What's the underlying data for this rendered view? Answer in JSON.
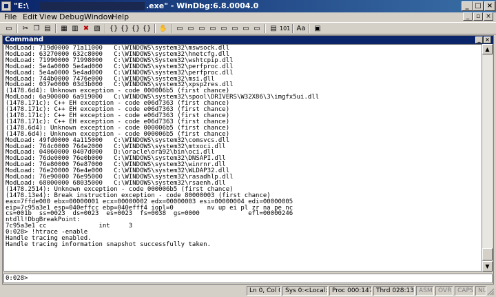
{
  "window": {
    "title_prefix": "\"E:\\",
    "title_suffix": ".exe\" - WinDbg:6.8.0004.0",
    "buttons": [
      "_",
      "□",
      "×"
    ]
  },
  "menu": [
    "File",
    "Edit",
    "View",
    "Debug",
    "Window",
    "Help"
  ],
  "toolbar_icons": [
    "open-icon",
    "cut-icon",
    "copy-icon",
    "paste-icon",
    "go-icon",
    "restart-icon",
    "stop-debugging-icon",
    "break-icon",
    "step-into-icon",
    "step-over-icon",
    "step-out-icon",
    "run-to-cursor-icon",
    "breakpoint-icon",
    "command-icon",
    "watch-icon",
    "locals-icon",
    "registers-icon",
    "memory-icon",
    "call-stack-icon",
    "disassembly-icon",
    "scratch-pad-icon",
    "source-mode-icon",
    "font-icon",
    "options-icon"
  ],
  "command_window": {
    "title": "Command",
    "output_lines": [
      "ModLoad: 719d0000 71a11000   C:\\WINDOWS\\system32\\mswsock.dll",
      "ModLoad: 63270000 632c8000   C:\\WINDOWS\\system32\\hnetcfg.dll",
      "ModLoad: 71990000 71998000   C:\\WINDOWS\\System32\\wshtcpip.dll",
      "ModLoad: 5e4a0000 5e4ad000   C:\\WINDOWS\\system32\\perfproc.dll",
      "ModLoad: 5e4a0000 5e4ad000   C:\\WINDOWS\\system32\\perfproc.dll",
      "ModLoad: 744b0000 7476e000   C:\\WINDOWS\\system32\\msi.dll",
      "ModLoad: 037e0000 03d3b000   C:\\WINDOWS\\system32\\xpsp2res.dll",
      "(1478.6d4): Unknown exception - code 000006b5 (first chance)",
      "ModLoad: 6a900000 6a919000   C:\\WINDOWS\\system32\\spool\\DRIVERS\\W32X86\\3\\imgfx5ui.dll",
      "(1478.171c): C++ EH exception - code e06d7363 (first chance)",
      "(1478.171c): C++ EH exception - code e06d7363 (first chance)",
      "(1478.171c): C++ EH exception - code e06d7363 (first chance)",
      "(1478.171c): C++ EH exception - code e06d7363 (first chance)",
      "(1478.6d4): Unknown exception - code 000006b5 (first chance)",
      "(1478.6d4): Unknown exception - code 000006b5 (first chance)",
      "ModLoad: 49fd0000 4a115000   C:\\WINDOWS\\system32\\comsvcs.dll",
      "ModLoad: 764c0000 764e2000   C:\\WINDOWS\\system32\\mtxoci.dll",
      "ModLoad: 04060000 0407d000   D:\\oracle\\ora92\\bin\\oci.dll",
      "ModLoad: 76de0000 76e0b000   C:\\WINDOWS\\system32\\DNSAPI.dll",
      "ModLoad: 76e80000 76e87000   C:\\WINDOWS\\system32\\winrnr.dll",
      "ModLoad: 76e20000 76e4e000   C:\\WINDOWS\\system32\\WLDAP32.dll",
      "ModLoad: 76e90000 76e95000   C:\\WINDOWS\\system32\\rasadhlp.dll",
      "ModLoad: 68000000 68035000   C:\\WINDOWS\\system32\\rsaenh.dll",
      "(1478.2514): Unknown exception - code 000006b5 (first chance)",
      "(1478.13e4): Break instruction exception - code 80000003 (first chance)",
      "eax=7ffde000 ebx=00000001 ecx=00000002 edx=00000003 esi=00000004 edi=00000005",
      "eip=7c95a3e1 esp=040effcc ebp=040efff4 iopl=0         nv up ei pl zr na pe nc",
      "cs=001b  ss=0023  ds=0023  es=0023  fs=0038  gs=0000             efl=00000246",
      "ntdll!DbgBreakPoint:",
      "7c95a3e1 cc              int     3",
      "0:028> !htrace -enable",
      "Handle tracing enabled.",
      "Handle tracing information snapshot successfully taken."
    ],
    "prompt": "0:028>"
  },
  "status_bar": {
    "ln_col": "Ln 0, Col 0",
    "sys": "Sys 0:<Local>",
    "proc": "Proc 000:1478",
    "thrd": "Thrd 028:13e4",
    "asm": "ASM",
    "ovr": "OVR",
    "caps": "CAPS",
    "num": "NUM"
  }
}
